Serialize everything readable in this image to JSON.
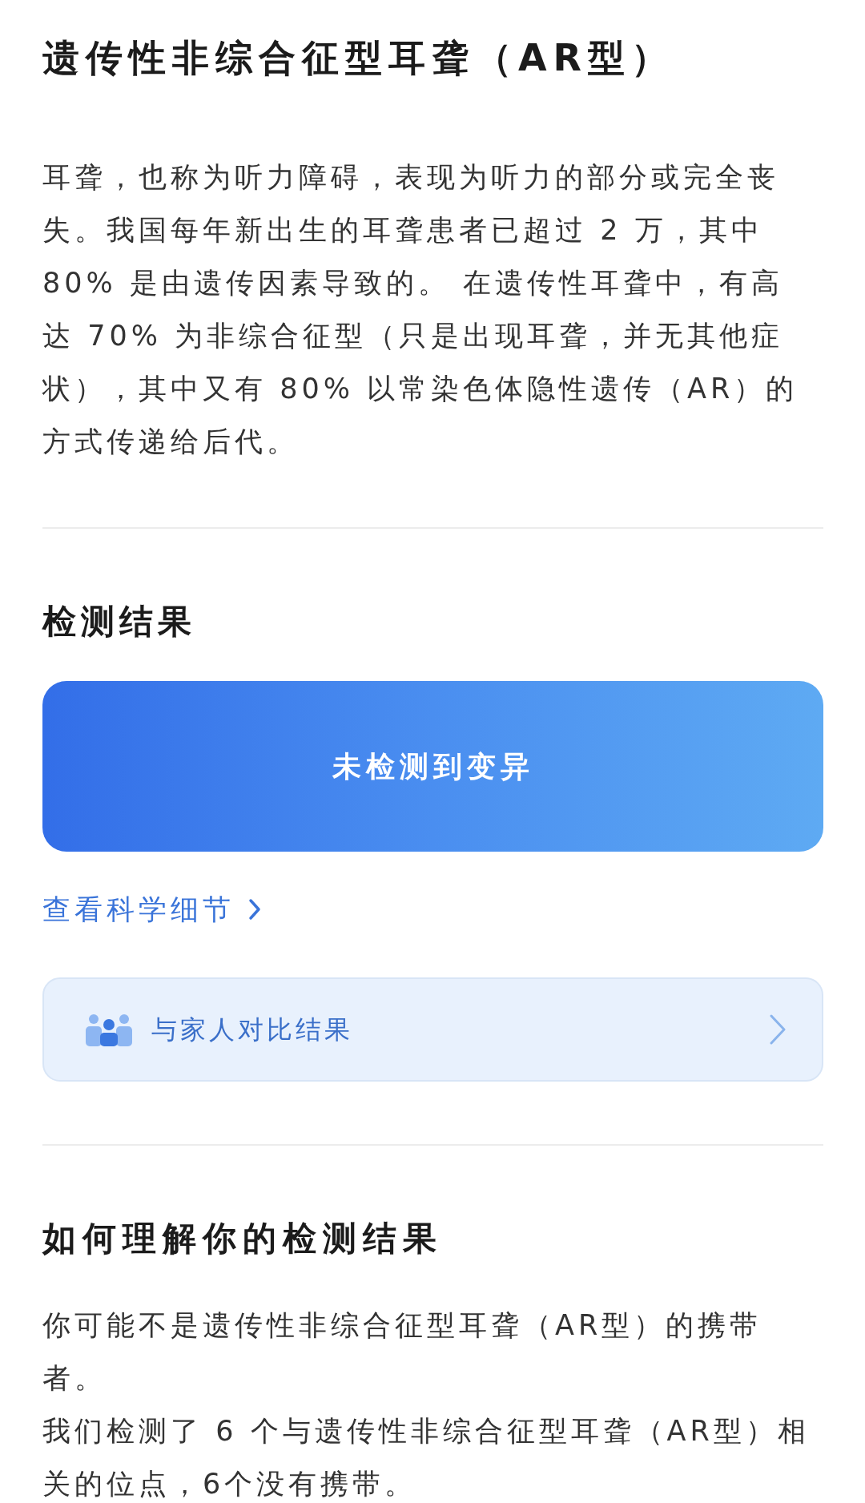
{
  "title": "遗传性非综合征型耳聋（AR型）",
  "intro": "耳聋，也称为听力障碍，表现为听力的部分或完全丧失。我国每年新出生的耳聋患者已超过 2 万，其中 80% 是由遗传因素导致的。 在遗传性耳聋中，有高达 70% 为非综合征型（只是出现耳聋，并无其他症状），其中又有 80% 以常染色体隐性遗传（AR）的方式传递给后代。",
  "result_section": {
    "heading": "检测结果",
    "result": {
      "label": "未检测到变异"
    },
    "details_link": {
      "label": "查看科学细节"
    },
    "family_compare": {
      "label": "与家人对比结果"
    }
  },
  "interpretation": {
    "heading": "如何理解你的检测结果",
    "paragraphs": [
      "你可能不是遗传性非综合征型耳聋（AR型）的携带者。",
      "我们检测了 6 个与遗传性非综合征型耳聋（AR型）相关的位点，6个没有携带。"
    ]
  }
}
